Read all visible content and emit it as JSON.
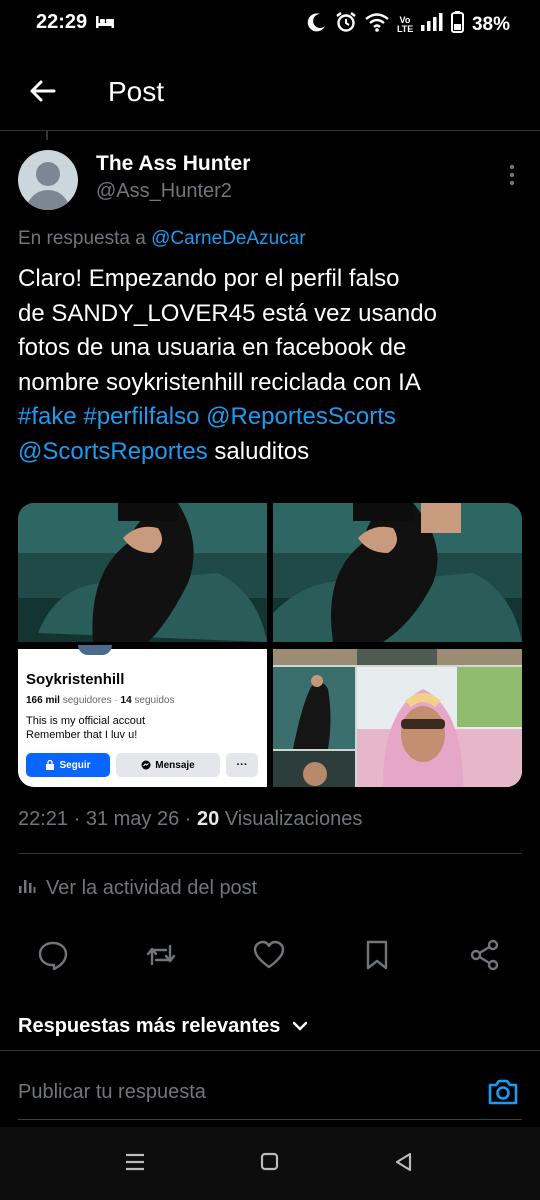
{
  "status_bar": {
    "time": "22:29",
    "sleep_glyph": "▬",
    "battery": "38%",
    "volte": "Vo LTE"
  },
  "header": {
    "title": "Post"
  },
  "author": {
    "name": "The Ass Hunter",
    "handle": "@Ass_Hunter2"
  },
  "reply_context": {
    "prefix": "En respuesta a ",
    "target": "@CarneDeAzucar"
  },
  "tweet": {
    "text_lines": [
      "Claro! Empezando por el perfil falso",
      "de SANDY_LOVER45 está vez usando",
      "fotos de una usuaria en facebook de",
      "nombre soykristenhill reciclada con IA"
    ],
    "tag_fake": "#fake",
    "tag_perfil": "#perfilfalso",
    "mention_1": "@ReportesScorts",
    "mention_2": "@ScortsReportes",
    "closing": " saluditos"
  },
  "media": {
    "fb_card": {
      "name": "Soykristenhill",
      "followers_count": "166 mil",
      "followers_label": " seguidores · ",
      "following_count": "14",
      "following_label": " seguidos",
      "bio_1": "This is my official accout",
      "bio_2": "Remember that I luv u!",
      "follow_button": "Seguir",
      "message_button": "Mensaje",
      "more_button": "···"
    }
  },
  "meta": {
    "time": "22:21",
    "date": "31 may 26",
    "views_count": "20",
    "views_label": "Visualizaciones",
    "sep": " · "
  },
  "activity_label": "Ver la actividad del post",
  "replies_sort_label": "Respuestas más relevantes",
  "reply_input": {
    "placeholder": "Publicar tu respuesta"
  },
  "colors": {
    "accent": "#1d9bf0",
    "background": "#000000",
    "muted": "#71767b"
  }
}
